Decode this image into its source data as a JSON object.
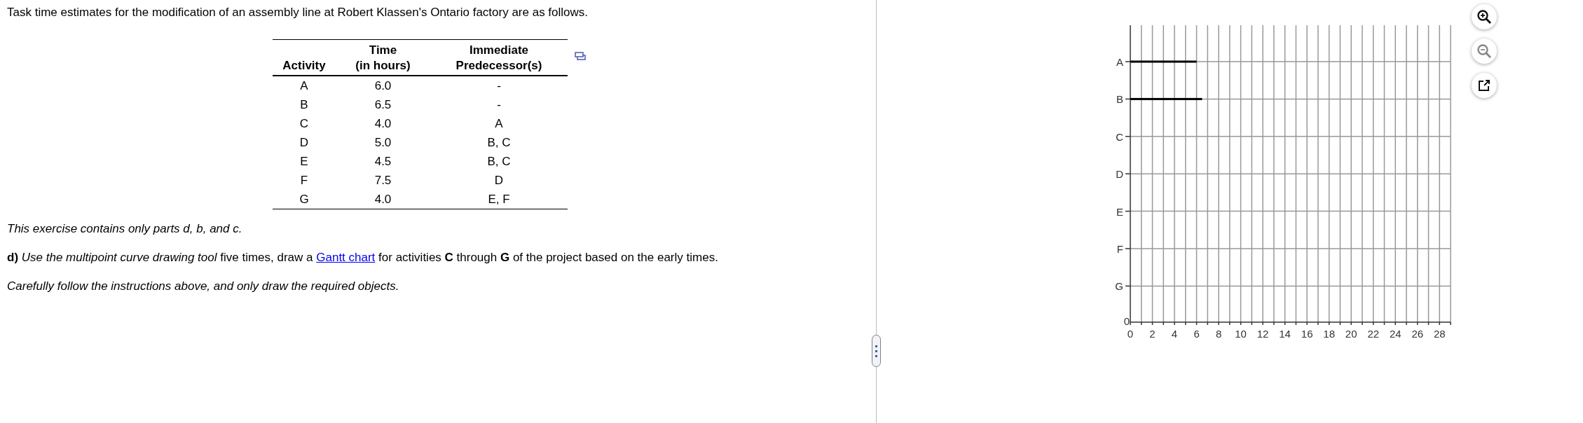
{
  "intro": "Task time estimates for the modification of an assembly line at Robert Klassen's Ontario factory are as follows.",
  "table": {
    "columns": [
      {
        "lines": [
          "Activity"
        ]
      },
      {
        "lines": [
          "Time",
          "(in hours)"
        ]
      },
      {
        "lines": [
          "Immediate",
          "Predecessor(s)"
        ]
      }
    ],
    "rows": [
      [
        "A",
        "6.0",
        "-"
      ],
      [
        "B",
        "6.5",
        "-"
      ],
      [
        "C",
        "4.0",
        "A"
      ],
      [
        "D",
        "5.0",
        "B, C"
      ],
      [
        "E",
        "4.5",
        "B, C"
      ],
      [
        "F",
        "7.5",
        "D"
      ],
      [
        "G",
        "4.0",
        "E, F"
      ]
    ]
  },
  "paragraphs": [
    {
      "kind": "note",
      "text": "This exercise contains only parts d, b, and c."
    },
    {
      "kind": "question",
      "before": "**d)** *Use the multipoint curve drawing tool* five times, draw a ",
      "link": "Gantt chart",
      "after": " for activities **C** through **G** of the project based on the early times."
    },
    {
      "kind": "note",
      "text": "Carefully follow the instructions above, and only draw the required objects."
    }
  ],
  "graph": {
    "chart_data": {
      "type": "bar",
      "orientation": "horizontal",
      "categories": [
        "A",
        "B",
        "C",
        "D",
        "E",
        "F",
        "G"
      ],
      "series": [
        {
          "color": "#000000",
          "values": [
            6,
            6.5,
            null,
            null,
            null,
            null,
            null
          ]
        }
      ],
      "xlim": [
        0,
        29
      ],
      "xticks": [
        0,
        2,
        4,
        6,
        8,
        10,
        12,
        14,
        16,
        18,
        20,
        22,
        24,
        26,
        28
      ],
      "grid": true
    },
    "origin_label": "0",
    "tools": [
      {
        "kind": "zoom-in",
        "disabled": false
      },
      {
        "kind": "zoom-out",
        "disabled": true
      },
      {
        "kind": "popout",
        "disabled": false
      }
    ]
  }
}
